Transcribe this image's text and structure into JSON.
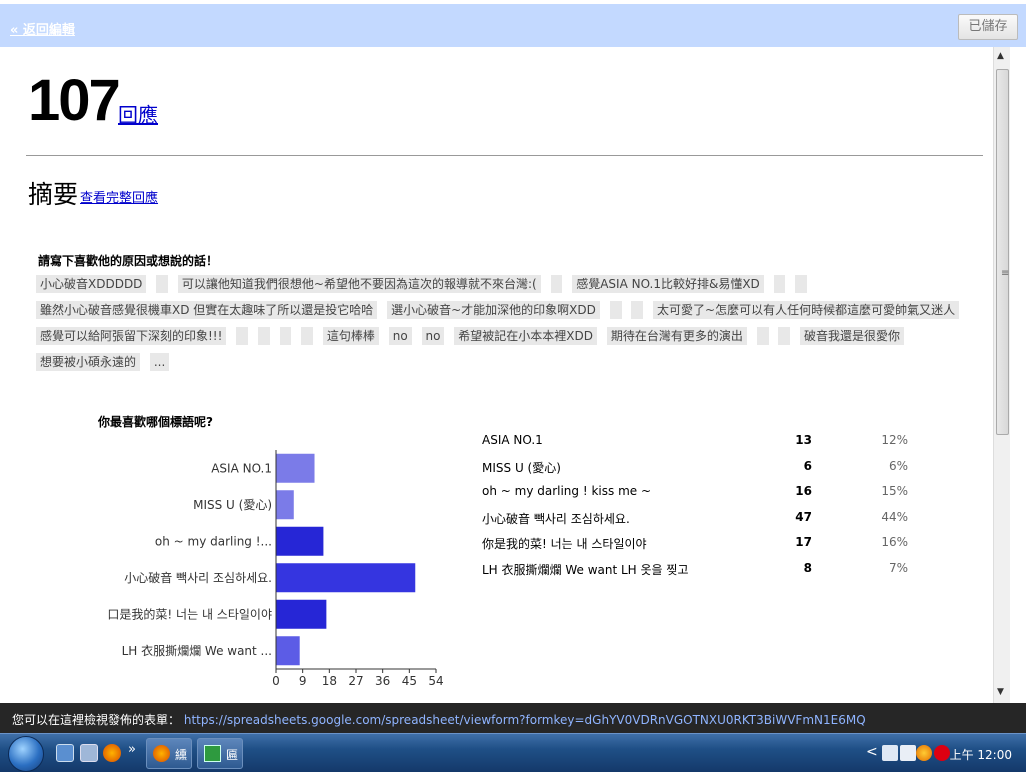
{
  "topbar": {
    "back_label": "« 返回編輯",
    "saved_label": "已儲存"
  },
  "header": {
    "count": "107",
    "responses_label": "回應"
  },
  "summary": {
    "title": "摘要",
    "full_link": "查看完整回應"
  },
  "question1": {
    "title": "請寫下喜歡他的原因或想說的話！",
    "answers": [
      "小心破音XDDDDD",
      "",
      "可以讓他知道我們很想他~希望他不要因為這次的報導就不來台灣:(",
      "",
      "感覺ASIA NO.1比較好排&易懂XD",
      "",
      "",
      "雖然小心破音感覺很機車XD 但實在太趣味了所以還是投它哈哈",
      "選小心破音~才能加深他的印象啊XDD",
      "",
      "",
      "太可愛了~怎麼可以有人任何時候都這麼可愛帥氣又迷人",
      "感覺可以給阿張留下深刻的印象!!!",
      "",
      "",
      "",
      "",
      "這句棒棒",
      "no",
      "no",
      "希望被記在小本本裡XDD",
      "期待在台灣有更多的演出",
      "",
      "",
      "破音我還是很愛你",
      "想要被小碩永遠的",
      "..."
    ]
  },
  "question2": {
    "title": "你最喜歡哪個標語呢?",
    "rows": [
      {
        "label": "ASIA NO.1",
        "count": "13",
        "pct": "12%"
      },
      {
        "label": "MISS U (愛心)",
        "count": "6",
        "pct": "6%"
      },
      {
        "label": "oh ~ my darling ! kiss me ~",
        "count": "16",
        "pct": "15%"
      },
      {
        "label": "小心破音 빽사리 조심하세요.",
        "count": "47",
        "pct": "44%"
      },
      {
        "label": "你是我的菜! 너는 내 스타일이야",
        "count": "17",
        "pct": "16%"
      },
      {
        "label": "LH 衣服撕爛爛 We want LH 옷을 찢고",
        "count": "8",
        "pct": "7%"
      }
    ]
  },
  "chart_data": {
    "type": "bar",
    "orientation": "horizontal",
    "categories": [
      "ASIA NO.1",
      "MISS U (愛心)",
      "oh ~ my darling !...",
      "小心破音 빽사리 조심하세요.",
      "口是我的菜! 너는 내 스타일이야",
      "LH 衣服撕爛爛 We want ..."
    ],
    "values": [
      13,
      6,
      16,
      47,
      17,
      8
    ],
    "xlim": [
      0,
      54
    ],
    "xticks": [
      "0",
      "9",
      "18",
      "27",
      "36",
      "45",
      "54"
    ],
    "colors": [
      "#7b7be8",
      "#7b7be8",
      "#2626d6",
      "#3535e0",
      "#2626d6",
      "#5c5ce6"
    ]
  },
  "statusbar": {
    "text": "您可以在這裡檢視發佈的表單：",
    "url": "https://spreadsheets.google.com/spreadsheet/viewform?formkey=dGhYV0VDRnVGOTNXU0RKT3BiWVFmN1E6MQ"
  },
  "taskbar": {
    "btn1": "纁",
    "btn2": "匾",
    "clock": "上午 12:00",
    "start_icon": "windows-logo",
    "chevron": "»",
    "tray_chevron": "<"
  }
}
